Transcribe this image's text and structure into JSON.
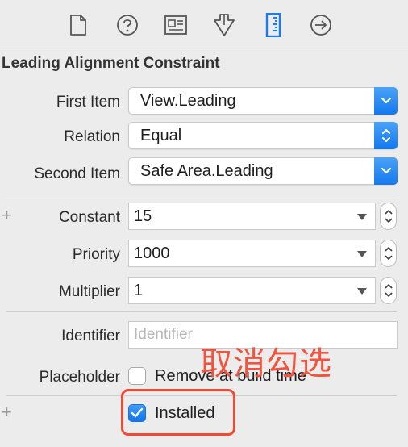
{
  "toolbar": {
    "icons": [
      "file-icon",
      "help-icon",
      "identity-icon",
      "attributes-icon",
      "size-ruler-icon",
      "connections-arrow-icon"
    ],
    "active_icon": "size-ruler-icon",
    "accent_color": "#1a7cf0"
  },
  "section_title": "Leading Alignment Constraint",
  "first_item": {
    "label": "First Item",
    "value": "View.Leading"
  },
  "relation": {
    "label": "Relation",
    "value": "Equal"
  },
  "second_item": {
    "label": "Second Item",
    "value": "Safe Area.Leading"
  },
  "constant": {
    "label": "Constant",
    "value": "15"
  },
  "priority": {
    "label": "Priority",
    "value": "1000"
  },
  "multiplier": {
    "label": "Multiplier",
    "value": "1"
  },
  "identifier": {
    "label": "Identifier",
    "value": "",
    "placeholder": "Identifier"
  },
  "placeholder_row": {
    "label": "Placeholder",
    "checkbox_label": "Remove at build time",
    "checked": false
  },
  "installed": {
    "checkbox_label": "Installed",
    "checked": true
  },
  "annotation": {
    "text": "取消勾选",
    "color": "#f0533e"
  }
}
